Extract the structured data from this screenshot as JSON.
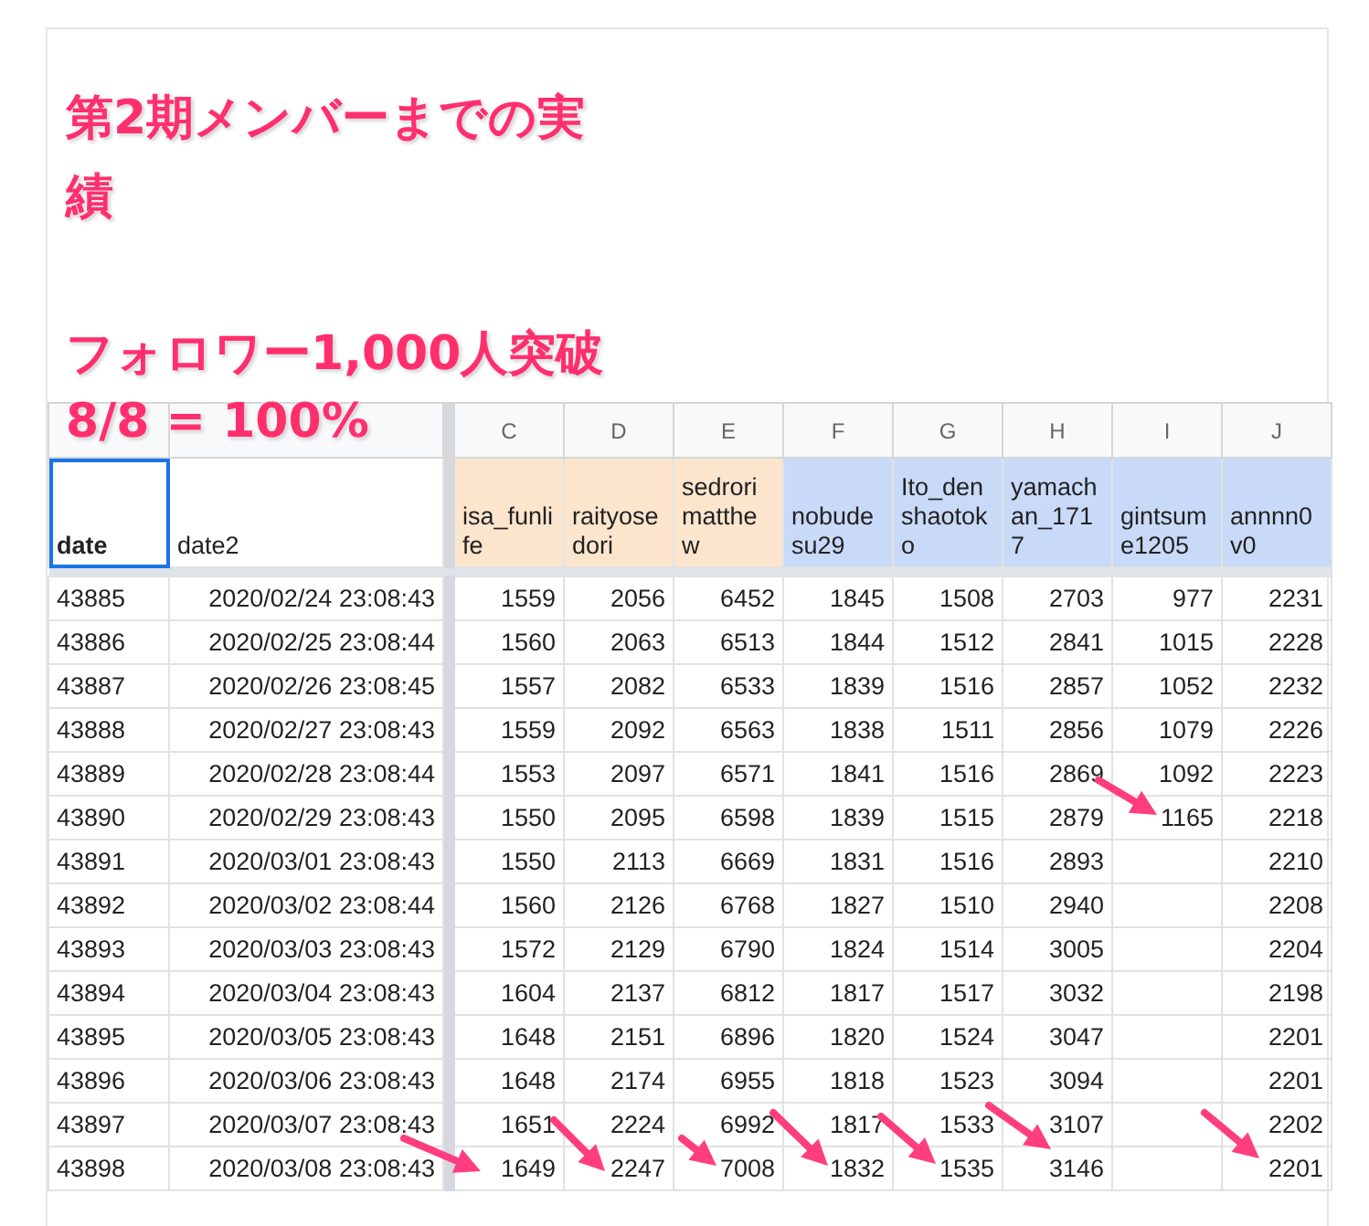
{
  "titles": [
    "第2期メンバーまでの実績",
    "フォロワー1,000人突破",
    "8/8 = 100%"
  ],
  "column_letters": [
    "C",
    "D",
    "E",
    "F",
    "G",
    "H",
    "I",
    "J"
  ],
  "headers": [
    {
      "label": "date",
      "bold": true,
      "selected": true
    },
    {
      "label": "date2",
      "bold": false,
      "selected": false
    },
    {
      "label": "isa_funlife",
      "bold": false,
      "selected": false,
      "color": "#fce5cd"
    },
    {
      "label": "raityosedori",
      "bold": false,
      "selected": false,
      "color": "#fce5cd"
    },
    {
      "label": "sedrorimatthew",
      "bold": false,
      "selected": false,
      "color": "#fce5cd"
    },
    {
      "label": "nobudesu29",
      "bold": false,
      "selected": false,
      "color": "#c9daf8"
    },
    {
      "label": "Ito_denshaotoko",
      "bold": false,
      "selected": false,
      "color": "#c9daf8"
    },
    {
      "label": "yamachan_1717",
      "bold": false,
      "selected": false,
      "color": "#c9daf8"
    },
    {
      "label": "gintsume1205",
      "bold": false,
      "selected": false,
      "color": "#c9daf8"
    },
    {
      "label": "annnn0v0",
      "bold": false,
      "selected": false,
      "color": "#c9daf8"
    }
  ],
  "rows": [
    {
      "date": "43885",
      "date2": "2020/02/24 23:08:43",
      "cells": {
        "C": "1559",
        "D": "2056",
        "E": "6452",
        "F": "1845",
        "G": "1508",
        "H": "2703",
        "I": "977",
        "J": "2231"
      }
    },
    {
      "date": "43886",
      "date2": "2020/02/25 23:08:44",
      "cells": {
        "C": "1560",
        "D": "2063",
        "E": "6513",
        "F": "1844",
        "G": "1512",
        "H": "2841",
        "I": "1015",
        "J": "2228"
      }
    },
    {
      "date": "43887",
      "date2": "2020/02/26 23:08:45",
      "cells": {
        "C": "1557",
        "D": "2082",
        "E": "6533",
        "F": "1839",
        "G": "1516",
        "H": "2857",
        "I": "1052",
        "J": "2232"
      }
    },
    {
      "date": "43888",
      "date2": "2020/02/27 23:08:43",
      "cells": {
        "C": "1559",
        "D": "2092",
        "E": "6563",
        "F": "1838",
        "G": "1511",
        "H": "2856",
        "I": "1079",
        "J": "2226"
      }
    },
    {
      "date": "43889",
      "date2": "2020/02/28 23:08:44",
      "cells": {
        "C": "1553",
        "D": "2097",
        "E": "6571",
        "F": "1841",
        "G": "1516",
        "H": "2869",
        "I": "1092",
        "J": "2223"
      }
    },
    {
      "date": "43890",
      "date2": "2020/02/29 23:08:43",
      "cells": {
        "C": "1550",
        "D": "2095",
        "E": "6598",
        "F": "1839",
        "G": "1515",
        "H": "2879",
        "I": "1165",
        "J": "2218"
      }
    },
    {
      "date": "43891",
      "date2": "2020/03/01 23:08:43",
      "cells": {
        "C": "1550",
        "D": "2113",
        "E": "6669",
        "F": "1831",
        "G": "1516",
        "H": "2893",
        "J": "2210"
      }
    },
    {
      "date": "43892",
      "date2": "2020/03/02 23:08:44",
      "cells": {
        "C": "1560",
        "D": "2126",
        "E": "6768",
        "F": "1827",
        "G": "1510",
        "H": "2940",
        "J": "2208"
      }
    },
    {
      "date": "43893",
      "date2": "2020/03/03 23:08:43",
      "cells": {
        "C": "1572",
        "D": "2129",
        "E": "6790",
        "F": "1824",
        "G": "1514",
        "H": "3005",
        "J": "2204"
      }
    },
    {
      "date": "43894",
      "date2": "2020/03/04 23:08:43",
      "cells": {
        "C": "1604",
        "D": "2137",
        "E": "6812",
        "F": "1817",
        "G": "1517",
        "H": "3032",
        "J": "2198"
      }
    },
    {
      "date": "43895",
      "date2": "2020/03/05 23:08:43",
      "cells": {
        "C": "1648",
        "D": "2151",
        "E": "6896",
        "F": "1820",
        "G": "1524",
        "H": "3047",
        "J": "2201"
      }
    },
    {
      "date": "43896",
      "date2": "2020/03/06 23:08:43",
      "cells": {
        "C": "1648",
        "D": "2174",
        "E": "6955",
        "F": "1818",
        "G": "1523",
        "H": "3094",
        "J": "2201"
      }
    },
    {
      "date": "43897",
      "date2": "2020/03/07 23:08:43",
      "cells": {
        "C": "1651",
        "D": "2224",
        "E": "6992",
        "F": "1817",
        "G": "1533",
        "H": "3107",
        "J": "2202"
      }
    },
    {
      "date": "43898",
      "date2": "2020/03/08 23:08:43",
      "cells": {
        "C": "1649",
        "D": "2247",
        "E": "7008",
        "F": "1832",
        "G": "1535",
        "H": "3146",
        "J": "2201"
      }
    }
  ]
}
